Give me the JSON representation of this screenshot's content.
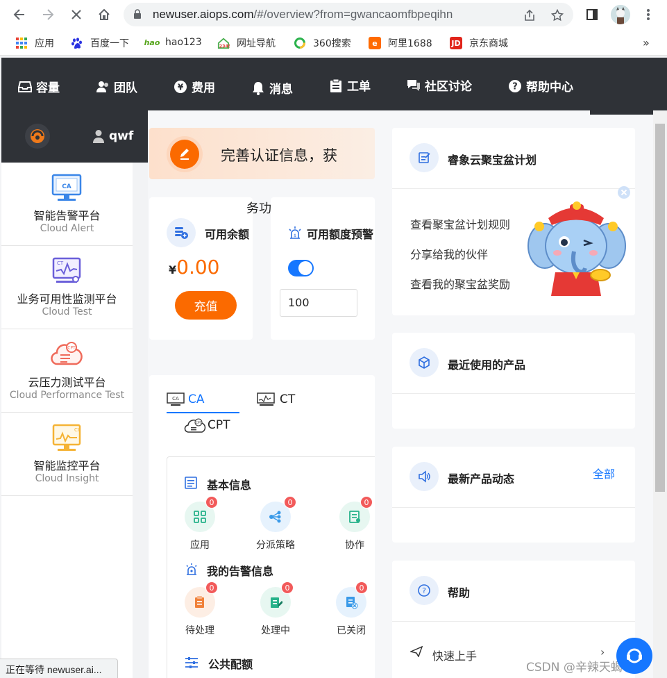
{
  "browser": {
    "url_host": "newuser.aiops.com",
    "url_path": "/#/overview?from=gwancaomfbpeqihn",
    "bookmarks": [
      "应用",
      "百度一下",
      "hao123",
      "网址导航",
      "360搜索",
      "阿里1688",
      "京东商城"
    ],
    "bookmark_more": "»",
    "status_text": "正在等待 newuser.ai..."
  },
  "topnav": {
    "items": [
      "容量",
      "团队",
      "费用",
      "消息",
      "工单",
      "社区讨论",
      "帮助中心"
    ]
  },
  "user": {
    "name": "qwf"
  },
  "sidebar": {
    "items": [
      {
        "cn": "智能告警平台",
        "en": "Cloud Alert"
      },
      {
        "cn": "业务可用性监测平台",
        "en": "Cloud Test"
      },
      {
        "cn": "云压力测试平台",
        "en": "Cloud Performance Test"
      },
      {
        "cn": "智能监控平台",
        "en": "Cloud Insight"
      }
    ]
  },
  "promo": {
    "text": "完善认证信息，获"
  },
  "balance": {
    "title": "可用余额",
    "currency": "¥",
    "amount": "0.00",
    "recharge_label": "充值",
    "overflow_text": "务功"
  },
  "alert_threshold": {
    "title": "可用额度预警",
    "enabled": true,
    "value": "100"
  },
  "products": {
    "tabs": [
      "CA",
      "CT",
      "CPT"
    ],
    "active_tab": "CA",
    "basic_info_title": "基本信息",
    "basic_items": [
      {
        "label": "应用",
        "count": "0"
      },
      {
        "label": "分派策略",
        "count": "0"
      },
      {
        "label": "协作",
        "count": "0"
      }
    ],
    "alert_info_title": "我的告警信息",
    "alert_items": [
      {
        "label": "待处理",
        "count": "0"
      },
      {
        "label": "处理中",
        "count": "0"
      },
      {
        "label": "已关闭",
        "count": "0"
      }
    ],
    "quota_title": "公共配额"
  },
  "plan": {
    "title": "睿象云聚宝盆计划",
    "links": [
      "查看聚宝盆计划规则",
      "分享给我的伙伴",
      "查看我的聚宝盆奖励"
    ]
  },
  "recent": {
    "title": "最近使用的产品"
  },
  "news": {
    "title": "最新产品动态",
    "all_label": "全部"
  },
  "help": {
    "title": "帮助",
    "quickstart": "快速上手"
  },
  "watermark": "CSDN @辛辣天蝎666",
  "colors": {
    "accent": "#fb6a00",
    "primary": "#1677ff",
    "nav_bg": "#2f3237"
  }
}
